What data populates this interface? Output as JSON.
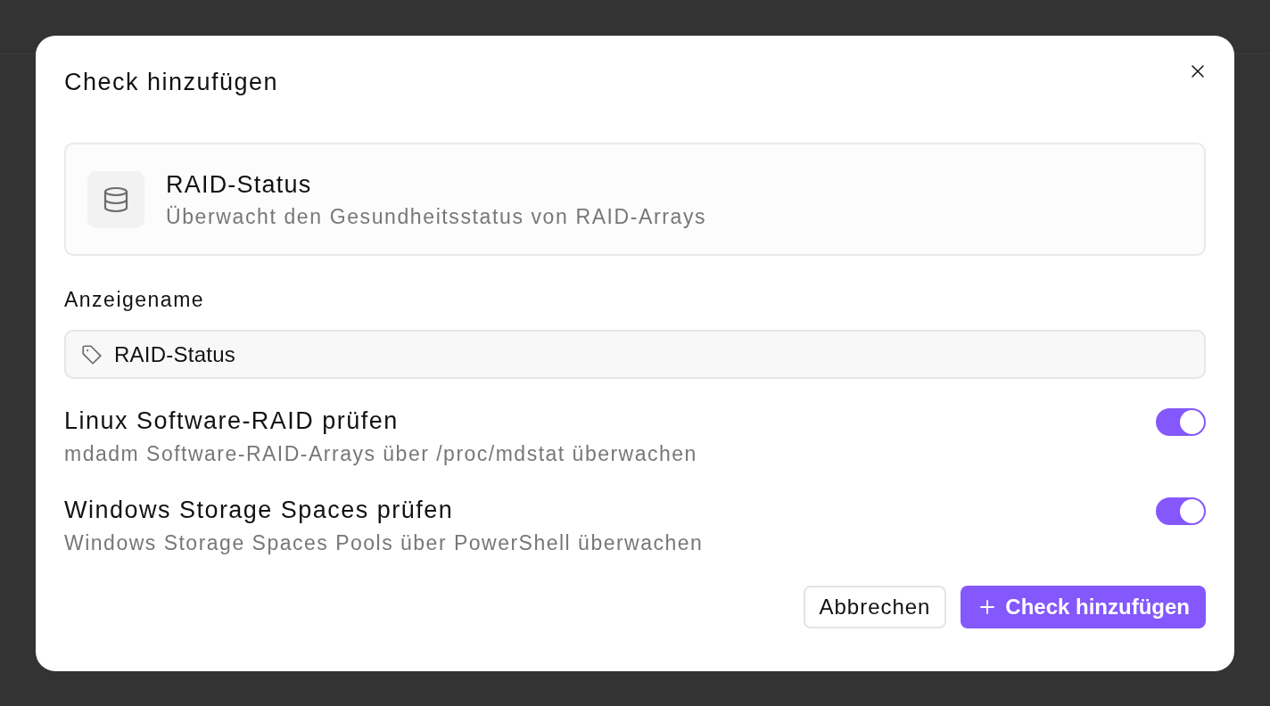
{
  "dialog": {
    "title": "Check hinzufügen"
  },
  "check_type": {
    "name": "RAID-Status",
    "description": "Überwacht den Gesundheitsstatus von RAID-Arrays"
  },
  "display_name": {
    "label": "Anzeigename",
    "value": "RAID-Status"
  },
  "options": [
    {
      "title": "Linux Software-RAID prüfen",
      "description": "mdadm Software-RAID-Arrays über /proc/mdstat überwachen",
      "on": true
    },
    {
      "title": "Windows Storage Spaces prüfen",
      "description": "Windows Storage Spaces Pools über PowerShell überwachen",
      "on": true
    }
  ],
  "buttons": [
    {
      "label": "Abbrechen",
      "kind": "secondary"
    },
    {
      "label": "Check hinzufügen",
      "kind": "primary"
    }
  ]
}
